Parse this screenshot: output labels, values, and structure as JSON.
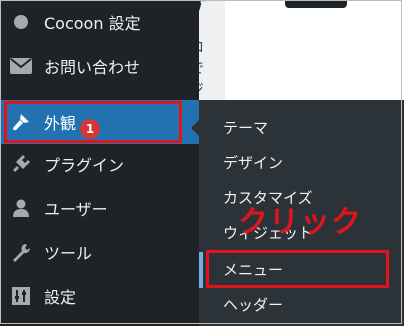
{
  "sidebar": {
    "items": [
      {
        "label": "Cocoon 設定",
        "icon": "circle-icon"
      },
      {
        "label": "お問い合わせ",
        "icon": "mail-icon"
      },
      {
        "label": "外観",
        "icon": "paintbrush-icon"
      },
      {
        "label": "プラグイン",
        "icon": "plugin-icon"
      },
      {
        "label": "ユーザー",
        "icon": "user-icon"
      },
      {
        "label": "ツール",
        "icon": "wrench-icon"
      },
      {
        "label": "設定",
        "icon": "settings-icon"
      }
    ]
  },
  "content": {
    "text_lines": [
      "ブロ",
      "トで",
      "ージ"
    ]
  },
  "submenu": {
    "items": [
      {
        "label": "テーマ"
      },
      {
        "label": "デザイン"
      },
      {
        "label": "カスタマイズ"
      },
      {
        "label": "ウィジェット"
      },
      {
        "label": "メニュー"
      },
      {
        "label": "ヘッダー"
      }
    ],
    "theme_badge": "1"
  },
  "annotation": {
    "click_text": "クリック"
  },
  "colors": {
    "sidebar_bg": "#1d2327",
    "submenu_bg": "#2c3338",
    "active_bg": "#2271b1",
    "highlight": "#e1141c",
    "badge": "#d63638"
  }
}
